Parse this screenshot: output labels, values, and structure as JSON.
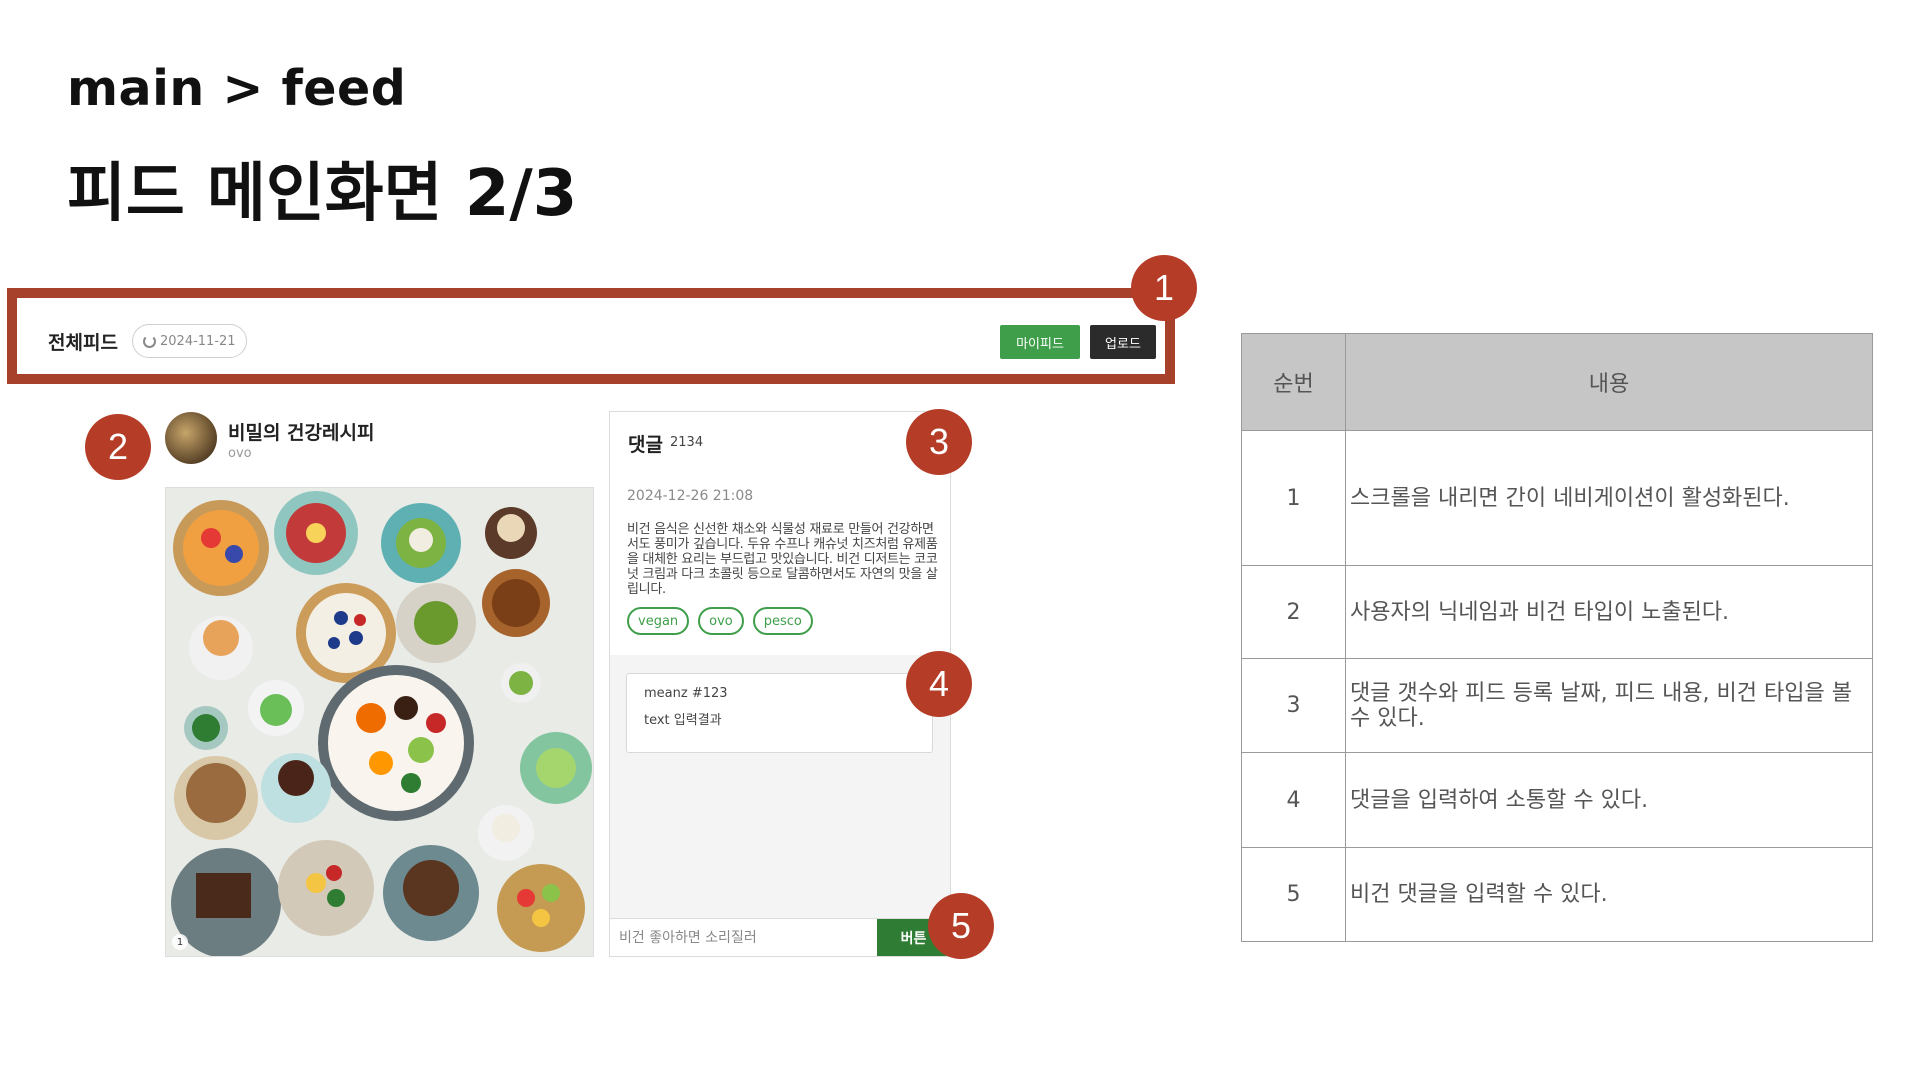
{
  "header": {
    "breadcrumb": "main > feed",
    "title": "피드 메인화면 2/3"
  },
  "nav": {
    "title": "전체피드",
    "date": "2024-11-21",
    "my_feed_label": "마이피드",
    "upload_label": "업로드"
  },
  "markers": [
    "1",
    "2",
    "3",
    "4",
    "5"
  ],
  "profile": {
    "name": "비밀의 건강레시피",
    "vegan_type": "ovo"
  },
  "image": {
    "counter": "1"
  },
  "comments": {
    "title": "댓글",
    "count": "2134",
    "feed_date": "2024-12-26 21:08",
    "feed_body": "비건 음식은 신선한 채소와 식물성 재료로 만들어 건강하면서도 풍미가 깊습니다. 두유 수프나 캐슈넛 치즈처럼 유제품을 대체한 요리는 부드럽고 맛있습니다. 비건 디저트는 코코넛 크림과 다크 초콜릿 등으로 달콤하면서도 자연의 맛을 살립니다.",
    "tags": [
      "vegan",
      "ovo",
      "pesco"
    ],
    "comment_user": "meanz  #123",
    "comment_text": "text 입력결과",
    "input_placeholder": "비건 좋아하면 소리질러",
    "submit_label": "버튼"
  },
  "table": {
    "headers": [
      "순번",
      "내용"
    ],
    "rows": [
      {
        "num": "1",
        "text": "스크롤을 내리면 간이 네비게이션이 활성화된다."
      },
      {
        "num": "2",
        "text": "사용자의 닉네임과 비건 타입이 노출된다."
      },
      {
        "num": "3",
        "text": "댓글 갯수와 피드 등록 날짜, 피드 내용, 비건 타입을 볼 수 있다."
      },
      {
        "num": "4",
        "text": "댓글을 입력하여 소통할 수 있다."
      },
      {
        "num": "5",
        "text": "비건 댓글을 입력할 수 있다."
      }
    ]
  },
  "colors": {
    "marker": "#b53d27",
    "frame": "#a8412b",
    "green": "#3e9e4a"
  }
}
